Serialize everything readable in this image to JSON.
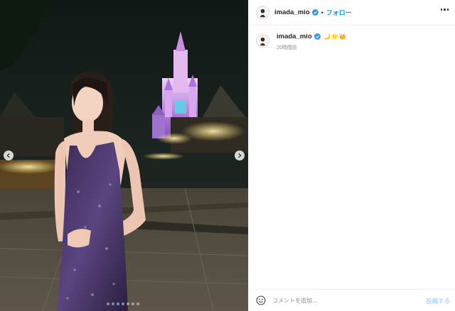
{
  "post": {
    "username": "imada_mio",
    "follow_separator": "•",
    "follow_label": "フォロー",
    "verified_icon": "verified-badge-icon",
    "more_icon": "more-options-icon",
    "caption_text": "🌙🌟👑",
    "timestamp": "20時間前",
    "carousel": {
      "slide_count": 7,
      "active_index": 2
    },
    "comment": {
      "placeholder": "コメントを追加...",
      "submit_label": "投稿する",
      "emoji_icon": "emoji-smile-icon"
    },
    "colors": {
      "accent": "#0095f6",
      "verified": "#3897f0",
      "submit_disabled": "#b3dbff",
      "muted": "#8e8e8e"
    }
  }
}
